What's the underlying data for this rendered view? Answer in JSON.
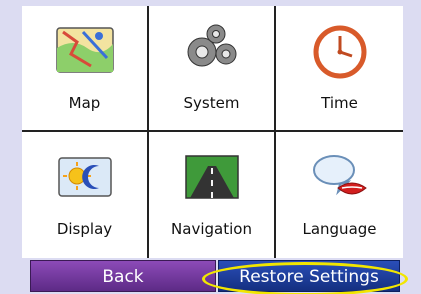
{
  "menu": {
    "items": [
      {
        "label": "Map",
        "icon": "map-icon"
      },
      {
        "label": "System",
        "icon": "gears-icon"
      },
      {
        "label": "Time",
        "icon": "clock-icon"
      },
      {
        "label": "Display",
        "icon": "sun-moon-icon"
      },
      {
        "label": "Navigation",
        "icon": "road-icon"
      },
      {
        "label": "Language",
        "icon": "speech-lips-icon"
      }
    ]
  },
  "bottom_bar": {
    "back_label": "Back",
    "restore_label": "Restore Settings"
  },
  "colors": {
    "background": "#dcdcf2",
    "back_button": "#6e35a0",
    "restore_button": "#1d3a99",
    "highlight": "#f2e600"
  }
}
